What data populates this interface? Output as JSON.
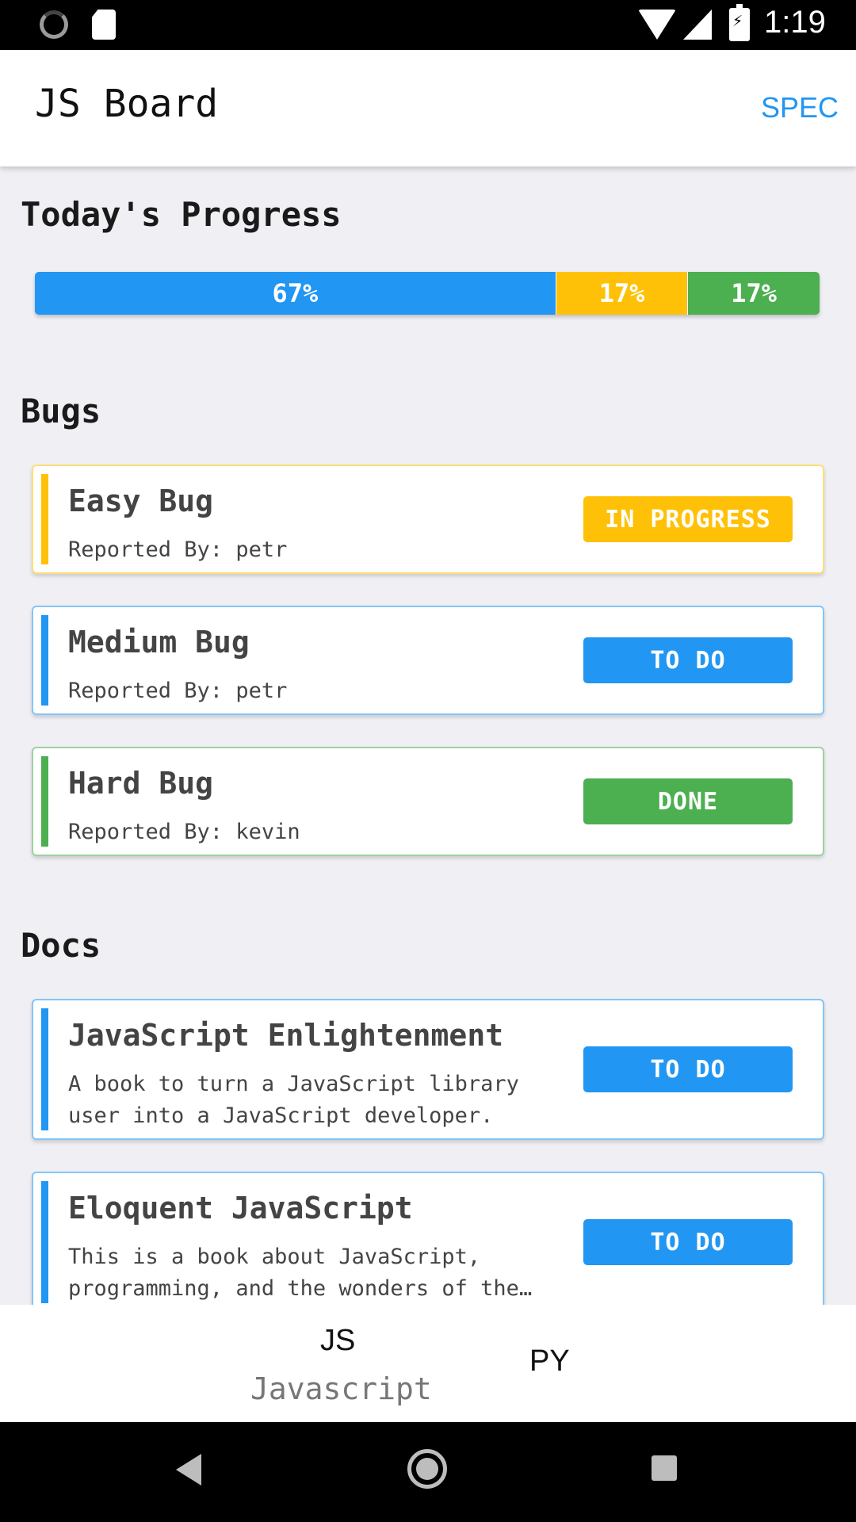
{
  "status_bar": {
    "time": "1:19"
  },
  "app_bar": {
    "title": "JS Board",
    "action": "SPEC"
  },
  "progress": {
    "title": "Today's Progress",
    "segments": [
      {
        "label": "67%",
        "value": 67,
        "color": "#2196f3"
      },
      {
        "label": "17%",
        "value": 17,
        "color": "#ffc107"
      },
      {
        "label": "17%",
        "value": 17,
        "color": "#4caf50"
      }
    ]
  },
  "bugs": {
    "title": "Bugs",
    "items": [
      {
        "title": "Easy Bug",
        "subtitle": "Reported By: petr",
        "status": "IN PROGRESS",
        "color": "#ffc107"
      },
      {
        "title": "Medium Bug",
        "subtitle": "Reported By: petr",
        "status": "TO DO",
        "color": "#2196f3"
      },
      {
        "title": "Hard Bug",
        "subtitle": "Reported By: kevin",
        "status": "DONE",
        "color": "#4caf50"
      }
    ]
  },
  "docs": {
    "title": "Docs",
    "items": [
      {
        "title": "JavaScript Enlightenment",
        "subtitle": "A book to turn a JavaScript library user into a JavaScript developer.",
        "status": "TO DO",
        "color": "#2196f3"
      },
      {
        "title": "Eloquent JavaScript",
        "subtitle": "This is a book about JavaScript, programming, and the wonders of the digital.",
        "status": "TO DO",
        "color": "#2196f3"
      }
    ]
  },
  "tabs": {
    "js_short": "JS",
    "js_long": "Javascript",
    "py_short": "PY"
  }
}
